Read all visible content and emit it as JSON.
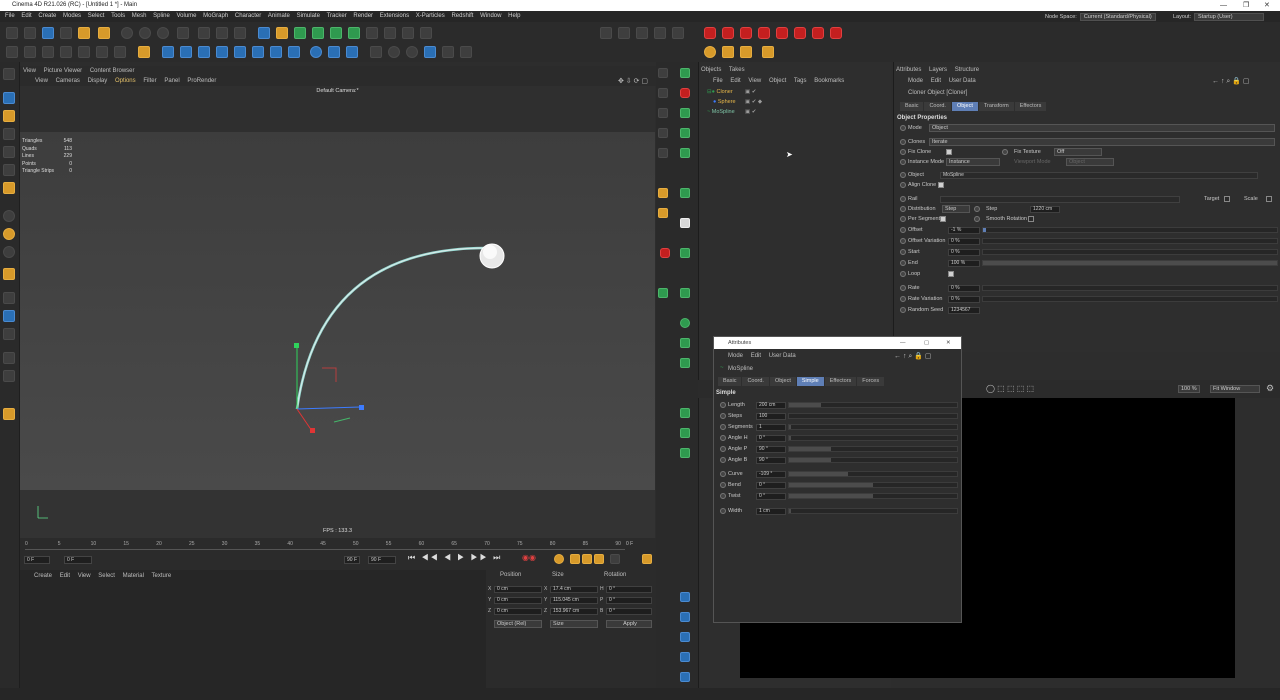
{
  "window": {
    "title": "Cinema 4D R21.026 (RC) - [Untitled 1 *] - Main"
  },
  "menu": [
    "File",
    "Edit",
    "Create",
    "Modes",
    "Select",
    "Tools",
    "Mesh",
    "Spline",
    "Volume",
    "MoGraph",
    "Character",
    "Animate",
    "Simulate",
    "Tracker",
    "Render",
    "Extensions",
    "X-Particles",
    "Redshift",
    "Window",
    "Help"
  ],
  "node_space": {
    "label": "Node Space:",
    "value": "Current (Standard/Physical)"
  },
  "layout": {
    "label": "Layout:",
    "value": "Startup (User)"
  },
  "viewport": {
    "tabs": [
      "View",
      "Picture Viewer",
      "Content Browser"
    ],
    "menu": [
      "View",
      "Cameras",
      "Display",
      "Options",
      "Filter",
      "Panel",
      "ProRender"
    ],
    "camera": "Default Camera:*",
    "stats": [
      {
        "k": "Triangles",
        "v": "548"
      },
      {
        "k": "Quads",
        "v": "113"
      },
      {
        "k": "Lines",
        "v": "229"
      },
      {
        "k": "Points",
        "v": "0"
      },
      {
        "k": "Triangle Strips",
        "v": "0"
      }
    ],
    "fps": "FPS : 133.3"
  },
  "timeline": {
    "ticks": [
      "0",
      "5",
      "10",
      "15",
      "20",
      "25",
      "30",
      "35",
      "40",
      "45",
      "50",
      "55",
      "60",
      "65",
      "70",
      "75",
      "80",
      "85",
      "90"
    ],
    "frame_right": "0 F",
    "start": "0 F",
    "current": "0 F",
    "end": "90 F",
    "max": "90 F"
  },
  "materials": {
    "menu": [
      "Create",
      "Edit",
      "View",
      "Select",
      "Material",
      "Texture"
    ]
  },
  "coords": {
    "headers": [
      "Position",
      "Size",
      "Rotation"
    ],
    "rows": [
      {
        "axis": "X",
        "pos": "0 cm",
        "saxis": "X",
        "size": "17.4 cm",
        "raxis": "H",
        "rot": "0 °"
      },
      {
        "axis": "Y",
        "pos": "0 cm",
        "saxis": "Y",
        "size": "115.045 cm",
        "raxis": "P",
        "rot": "0 °"
      },
      {
        "axis": "Z",
        "pos": "0 cm",
        "saxis": "Z",
        "size": "153.967 cm",
        "raxis": "B",
        "rot": "0 °"
      }
    ],
    "mode": "Object (Rel)",
    "size_mode": "Size",
    "apply": "Apply"
  },
  "objects": {
    "tabs": [
      "Objects",
      "Takes"
    ],
    "menu": [
      "File",
      "Edit",
      "View",
      "Object",
      "Tags",
      "Bookmarks"
    ],
    "tree": [
      {
        "name": "Cloner",
        "color": "#e7b74a"
      },
      {
        "name": "Sphere",
        "color": "#e7b74a"
      },
      {
        "name": "MoSpline",
        "color": "#7ec4a6"
      }
    ]
  },
  "attributes": {
    "tabs": [
      "Attributes",
      "Layers",
      "Structure"
    ],
    "menu": [
      "Mode",
      "Edit",
      "User Data"
    ],
    "object_name": "Cloner Object [Cloner]",
    "subtabs": [
      "Basic",
      "Coord.",
      "Object",
      "Transform",
      "Effectors"
    ],
    "active_tab": "Object",
    "section": "Object Properties",
    "mode_label": "Mode",
    "mode_value": "Object",
    "clones_label": "Clones",
    "clones_value": "Iterate",
    "fix_clone": "Fix Clone",
    "fix_texture": "Fix Texture",
    "fix_texture_val": "Off",
    "instance_mode": "Instance Mode",
    "instance_val": "Instance",
    "viewport_mode": "Viewport Mode",
    "viewport_val": "Object",
    "object_label": "Object",
    "object_val": "MoSpline",
    "align_clone": "Align Clone",
    "rail": "Rail",
    "target": "Target",
    "scale": "Scale",
    "distribution": "Distribution",
    "distribution_val": "Step",
    "step": "Step",
    "step_val": "1220 cm",
    "per_segment": "Per Segment",
    "smooth_rotation": "Smooth Rotation",
    "offset": "Offset",
    "offset_val": "-1 %",
    "offset_variation": "Offset Variation",
    "offset_variation_val": "0 %",
    "start": "Start",
    "start_val": "0 %",
    "end": "End",
    "end_val": "100 %",
    "loop": "Loop",
    "rate": "Rate",
    "rate_val": "0 %",
    "rate_variation": "Rate Variation",
    "rate_variation_val": "0 %",
    "random_seed": "Random Seed",
    "random_seed_val": "1234567"
  },
  "floating": {
    "title": "Attributes",
    "menu": [
      "Mode",
      "Edit",
      "User Data"
    ],
    "object": "MoSpline",
    "tabs": [
      "Basic",
      "Coord.",
      "Object",
      "Simple",
      "Effectors",
      "Forces"
    ],
    "active_tab": "Simple",
    "section": "Simple",
    "params": [
      {
        "label": "Length",
        "value": "200 cm",
        "fill": 0.19
      },
      {
        "label": "Steps",
        "value": "100",
        "fill": 0
      },
      {
        "label": "Segments",
        "value": "1",
        "fill": 0.01
      },
      {
        "label": "Angle H",
        "value": "0 °",
        "fill": 0.01
      },
      {
        "label": "Angle P",
        "value": "90 °",
        "fill": 0.25
      },
      {
        "label": "Angle B",
        "value": "90 °",
        "fill": 0.25
      },
      {
        "label": "Curve",
        "value": "-109 °",
        "fill": 0.35
      },
      {
        "label": "Bend",
        "value": "0 °",
        "fill": 0.5
      },
      {
        "label": "Twist",
        "value": "0 °",
        "fill": 0.5
      },
      {
        "label": "Width",
        "value": "1 cm",
        "fill": 0.01
      }
    ]
  },
  "render": {
    "zoom": "100 %",
    "fit": "Fit Window"
  }
}
